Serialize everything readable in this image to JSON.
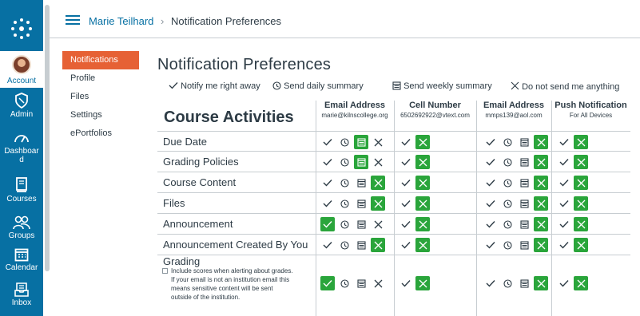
{
  "nav": {
    "account": "Account",
    "admin": "Admin",
    "dashboard_line1": "Dashboar",
    "dashboard_line2": "d",
    "courses": "Courses",
    "groups": "Groups",
    "calendar": "Calendar",
    "inbox": "Inbox",
    "bg_color": "#0770a3"
  },
  "breadcrumb": {
    "user": "Marie Teilhard",
    "separator": "›",
    "current": "Notification Preferences"
  },
  "section_nav": [
    "Notifications",
    "Profile",
    "Files",
    "Settings",
    "ePortfolios"
  ],
  "page_title": "Notification Preferences",
  "legend": {
    "right_away": "Notify me right away",
    "daily": "Send daily summary",
    "weekly": "Send weekly summary",
    "never": "Do not send me anything"
  },
  "table": {
    "section_title": "Course Activities",
    "columns": [
      {
        "title": "Email Address",
        "subtitle": "marie@kilnscollege.org"
      },
      {
        "title": "Cell Number",
        "subtitle": "6502692922@vtext.com"
      },
      {
        "title": "Email Address",
        "subtitle": "mmps139@aol.com"
      },
      {
        "title": "Push Notification",
        "subtitle": "For All Devices"
      }
    ],
    "rows": [
      {
        "label": "Due Date",
        "selected": [
          "weekly",
          "never",
          "never",
          "never"
        ]
      },
      {
        "label": "Grading Policies",
        "selected": [
          "weekly",
          "never",
          "never",
          "never"
        ]
      },
      {
        "label": "Course Content",
        "selected": [
          "never",
          "never",
          "never",
          "never"
        ]
      },
      {
        "label": "Files",
        "selected": [
          "never",
          "never",
          "never",
          "never"
        ]
      },
      {
        "label": "Announcement",
        "selected": [
          "right_away",
          "never",
          "never",
          "never"
        ]
      },
      {
        "label": "Announcement Created By You",
        "selected": [
          "never",
          "never",
          "never",
          "never"
        ]
      },
      {
        "label": "Grading",
        "selected": [
          "right_away",
          "never",
          "never",
          "never"
        ]
      }
    ],
    "grading_note_line1": "Include scores when alerting about grades.",
    "grading_note_line2": "If your email is not an institution email this",
    "grading_note_line3": "means sensitive content will be sent",
    "grading_note_line4": "outside of the institution."
  },
  "colors": {
    "selected_green": "#2aa53b",
    "active_tab": "#e66135",
    "link": "#0770a3"
  }
}
